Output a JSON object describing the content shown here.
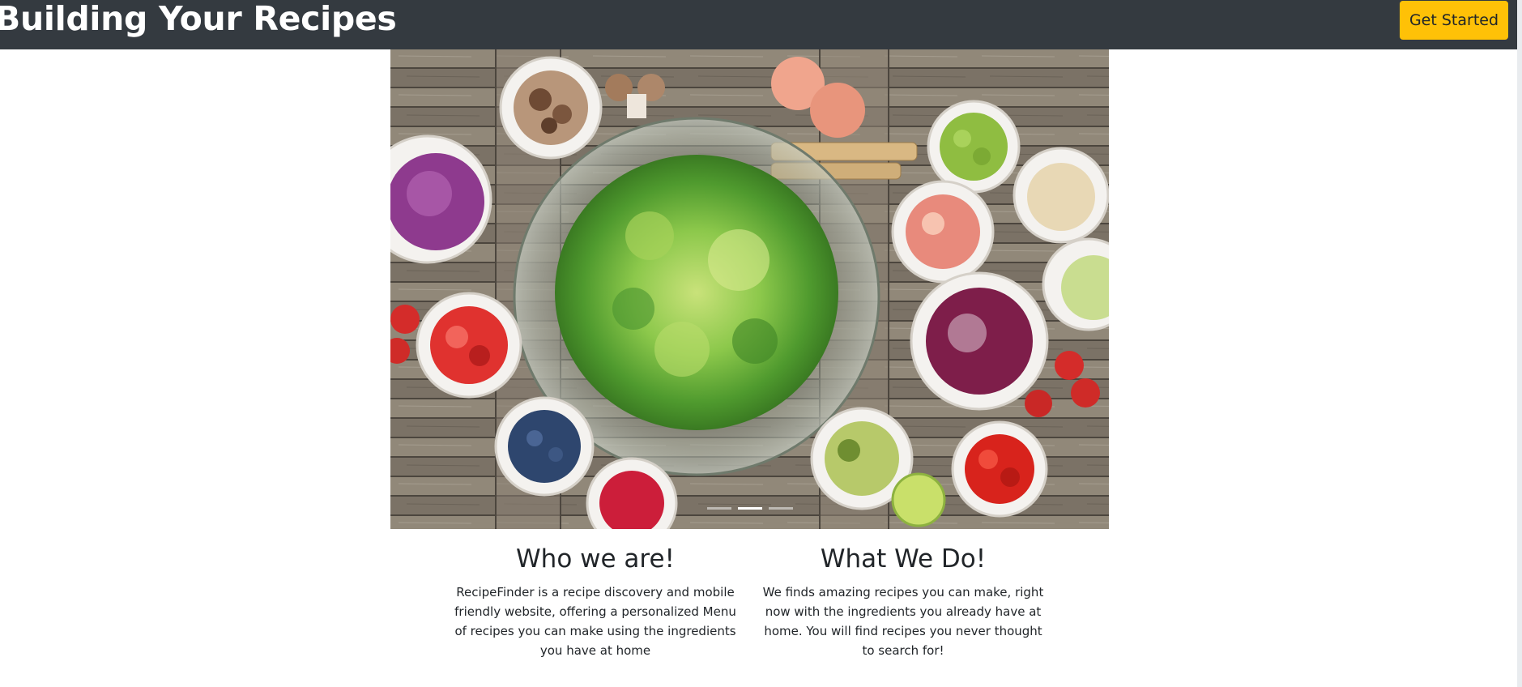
{
  "navbar": {
    "brand": "Building Your Recipes",
    "cta_label": "Get Started",
    "background": "#343a40",
    "cta_color": "#ffc107"
  },
  "carousel": {
    "image_alt": "Salad and fresh produce on a wooden table",
    "slide_count": 3,
    "active_index": 1
  },
  "sections": {
    "who": {
      "title": "Who we are!",
      "body": "RecipeFinder is a recipe discovery and mobile friendly website, offering a personalized Menu of recipes you can make using the ingredients you have at home"
    },
    "what": {
      "title": "What We Do!",
      "body": "We finds amazing recipes you can make, right now with the ingredients you already have at home. You will find recipes you never thought to search for!"
    }
  }
}
